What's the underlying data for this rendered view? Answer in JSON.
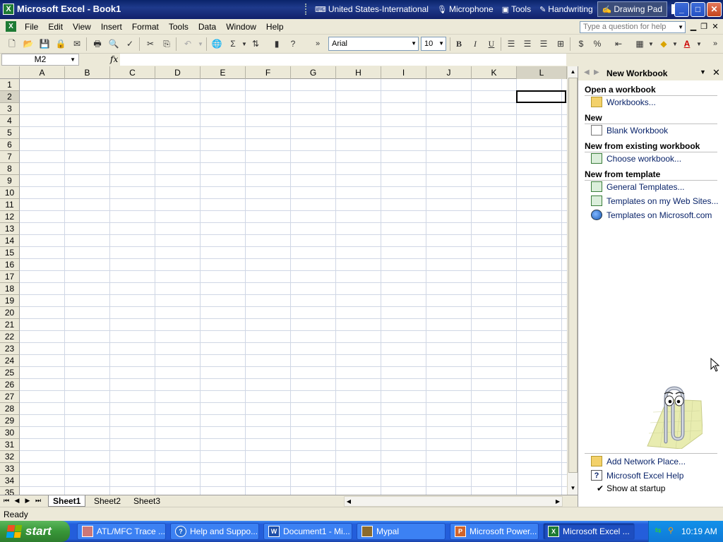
{
  "window": {
    "title": "Microsoft Excel - Book1",
    "app_icon_letter": "X"
  },
  "language_bar": {
    "items": [
      {
        "label": "United States-International",
        "icon": "keyboard-icon"
      },
      {
        "label": "Microphone",
        "icon": "microphone-icon"
      },
      {
        "label": "Tools",
        "icon": "tools-icon"
      },
      {
        "label": "Handwriting",
        "icon": "handwriting-icon"
      },
      {
        "label": "Drawing Pad",
        "icon": "drawing-pad-icon"
      }
    ],
    "help_glyph": "?"
  },
  "window_controls": {
    "minimize": "_",
    "maximize": "□",
    "close": "✕"
  },
  "menu": {
    "items": [
      "File",
      "Edit",
      "View",
      "Insert",
      "Format",
      "Tools",
      "Data",
      "Window",
      "Help"
    ],
    "help_placeholder": "Type a question for help"
  },
  "toolbar": {
    "font": "Arial",
    "size": "10",
    "bold": "B",
    "italic": "I",
    "underline": "U",
    "sigma": "Σ",
    "currency": "$",
    "percent": "%"
  },
  "formula_bar": {
    "name_box": "M2",
    "fx": "fx",
    "formula": ""
  },
  "grid": {
    "columns": [
      "A",
      "B",
      "C",
      "D",
      "E",
      "F",
      "G",
      "H",
      "I",
      "J",
      "K",
      "L"
    ],
    "rows": [
      "1",
      "2",
      "3",
      "4",
      "5",
      "6",
      "7",
      "8",
      "9",
      "10",
      "11",
      "12",
      "13",
      "14",
      "15",
      "16",
      "17",
      "18",
      "19",
      "20",
      "21",
      "22",
      "23",
      "24",
      "25",
      "26",
      "27",
      "28",
      "29",
      "30",
      "31",
      "32",
      "33",
      "34",
      "35"
    ],
    "selected_column": "L",
    "selected_row": "2"
  },
  "sheets": {
    "tabs": [
      "Sheet1",
      "Sheet2",
      "Sheet3"
    ],
    "active": "Sheet1"
  },
  "status": {
    "text": "Ready"
  },
  "task_pane": {
    "title": "New Workbook",
    "sections": [
      {
        "heading": "Open a workbook",
        "links": [
          {
            "label": "Workbooks...",
            "icon": "folder-icon"
          }
        ]
      },
      {
        "heading": "New",
        "links": [
          {
            "label": "Blank Workbook",
            "icon": "blank-document-icon"
          }
        ]
      },
      {
        "heading": "New from existing workbook",
        "links": [
          {
            "label": "Choose workbook...",
            "icon": "workbook-icon"
          }
        ]
      },
      {
        "heading": "New from template",
        "links": [
          {
            "label": "General Templates...",
            "icon": "template-icon"
          },
          {
            "label": "Templates on my Web Sites...",
            "icon": "web-template-icon"
          },
          {
            "label": "Templates on Microsoft.com",
            "icon": "globe-icon"
          }
        ]
      }
    ],
    "footer_links": [
      {
        "label": "Add Network Place...",
        "icon": "network-folder-icon"
      },
      {
        "label": "Microsoft Excel Help",
        "icon": "help-icon"
      }
    ],
    "show_at_startup": {
      "label": "Show at startup",
      "checked": true
    }
  },
  "taskbar": {
    "start_label": "start",
    "tasks": [
      {
        "label": "ATL/MFC Trace ...",
        "icon": "app-icon"
      },
      {
        "label": "Help and Suppo...",
        "icon": "help-center-icon"
      },
      {
        "label": "Document1 - Mi...",
        "icon": "word-icon"
      },
      {
        "label": "Mypal",
        "icon": "mypal-icon"
      },
      {
        "label": "Microsoft Power...",
        "icon": "powerpoint-icon"
      },
      {
        "label": "Microsoft Excel ...",
        "icon": "excel-icon"
      }
    ],
    "active_task": "Microsoft Excel ...",
    "clock": "10:19 AM"
  },
  "colors": {
    "titlebar": "#0a246a",
    "chrome": "#ece9d8",
    "taskbar": "#245edb",
    "start": "#389638",
    "link": "#0a246a"
  }
}
